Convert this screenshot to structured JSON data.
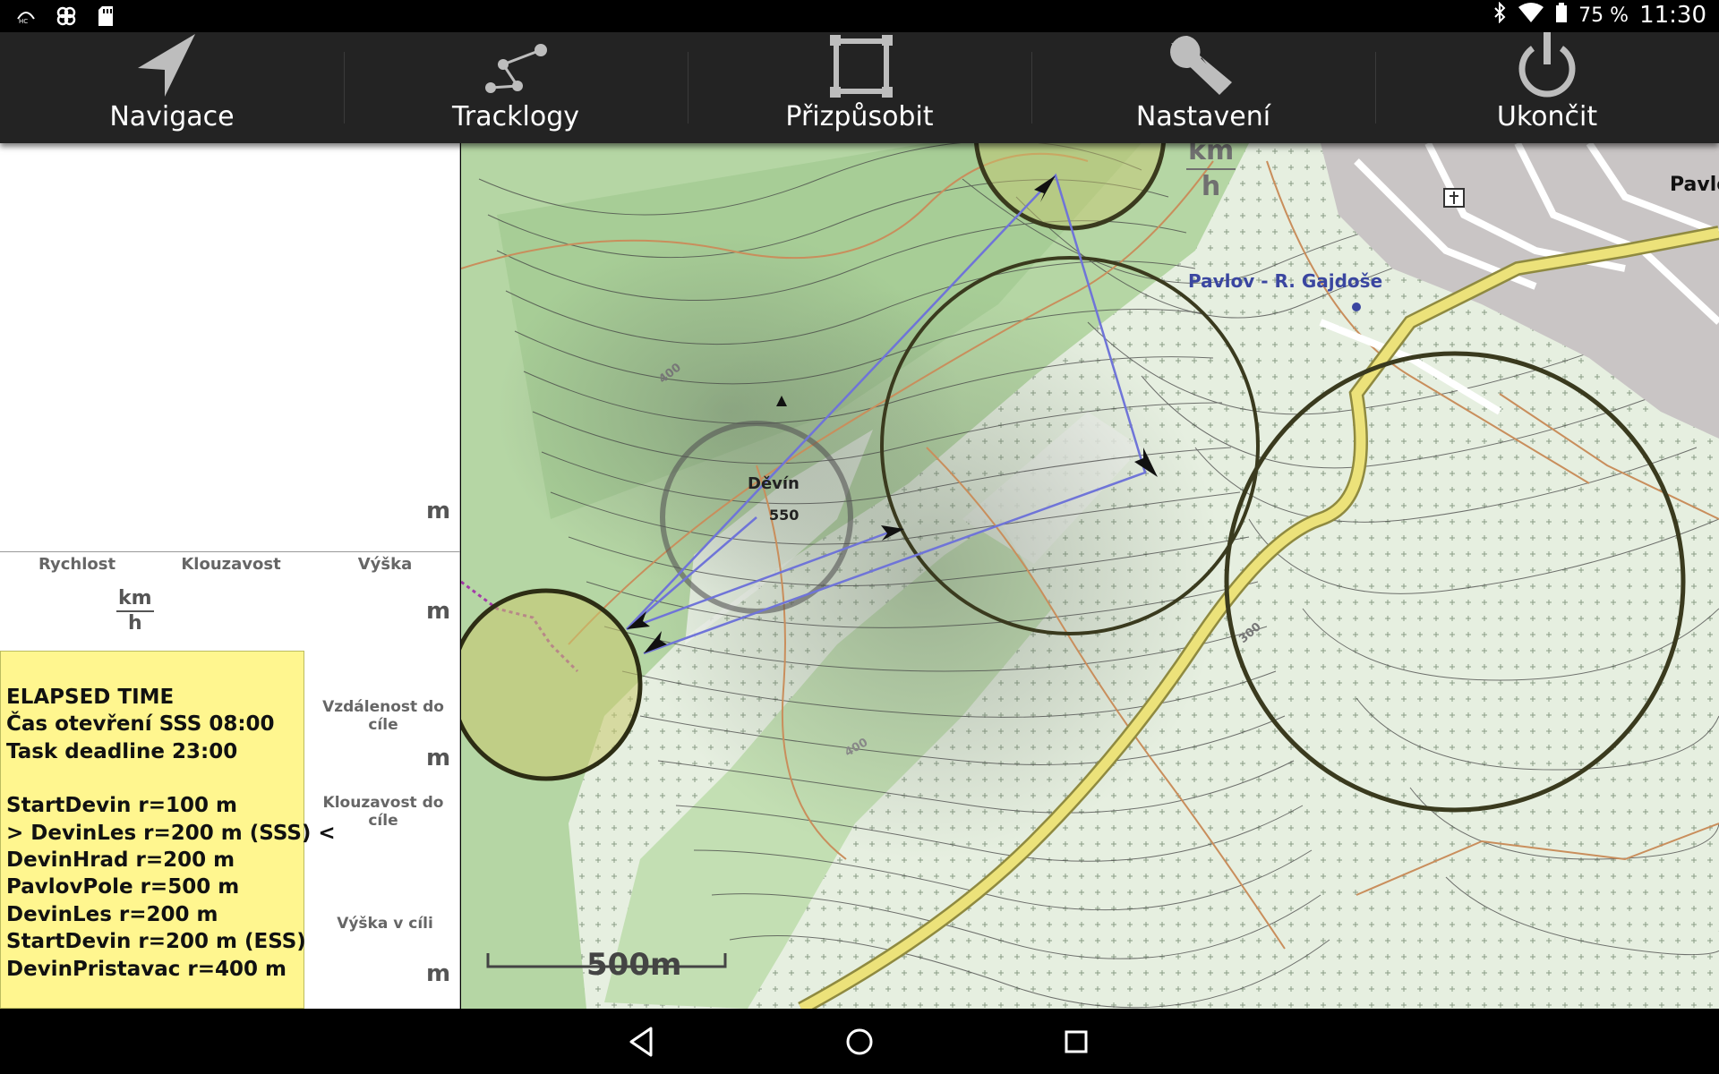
{
  "status_bar": {
    "battery": "75 %",
    "time": "11:30",
    "icons": [
      "hd-icon",
      "sync-icon",
      "sd-card-icon",
      "bluetooth-icon",
      "wifi-icon",
      "battery-icon"
    ]
  },
  "menu": {
    "items": [
      {
        "label": "Navigace",
        "icon": "navigation-arrow-icon"
      },
      {
        "label": "Tracklogy",
        "icon": "tracklog-icon"
      },
      {
        "label": "Přizpůsobit",
        "icon": "fit-screen-icon"
      },
      {
        "label": "Nastavení",
        "icon": "wrench-icon"
      },
      {
        "label": "Ukončit",
        "icon": "power-icon"
      }
    ]
  },
  "panel": {
    "graph_unit": "m",
    "labels": {
      "speed": "Rychlost",
      "glide": "Klouzavost",
      "altitude": "Výška",
      "distance_to_goal": "Vzdálenost do cíle",
      "glide_to_goal": "Klouzavost do cíle",
      "altitude_at_goal": "Výška v cíli"
    },
    "units": {
      "speed_num": "km",
      "speed_den": "h",
      "altitude": "m",
      "distance_to_goal": "m",
      "altitude_at_goal": "m"
    },
    "task": {
      "header": [
        "ELAPSED TIME",
        "Čas otevření SSS 08:00",
        "Task deadline 23:00"
      ],
      "turnpoints": [
        "StartDevin r=100 m",
        "> DevinLes r=200 m (SSS) <",
        "DevinHrad r=200 m",
        "PavlovPole r=500 m",
        "DevinLes r=200 m",
        "StartDevin r=200 m (ESS)",
        "DevinPristavac r=400 m"
      ]
    }
  },
  "map": {
    "peak_name": "Děvín",
    "peak_elevation": "550",
    "contour_labels": [
      "400",
      "400",
      "300"
    ],
    "place_label": "Pavlov - R. Gajdoše",
    "town_label_partial": "Pavlo",
    "overlay_unit_num": "km",
    "overlay_unit_den": "h",
    "scale_label": "500m",
    "colors": {
      "route": "#6f74d8",
      "cylinder_stroke": "#3a3a1e",
      "cylinder_fill": "#c9c86e",
      "forest": "#b8d8a8",
      "road": "#e3d86a"
    }
  },
  "nav_bar": {
    "buttons": [
      "back-icon",
      "home-icon",
      "recents-icon"
    ]
  }
}
